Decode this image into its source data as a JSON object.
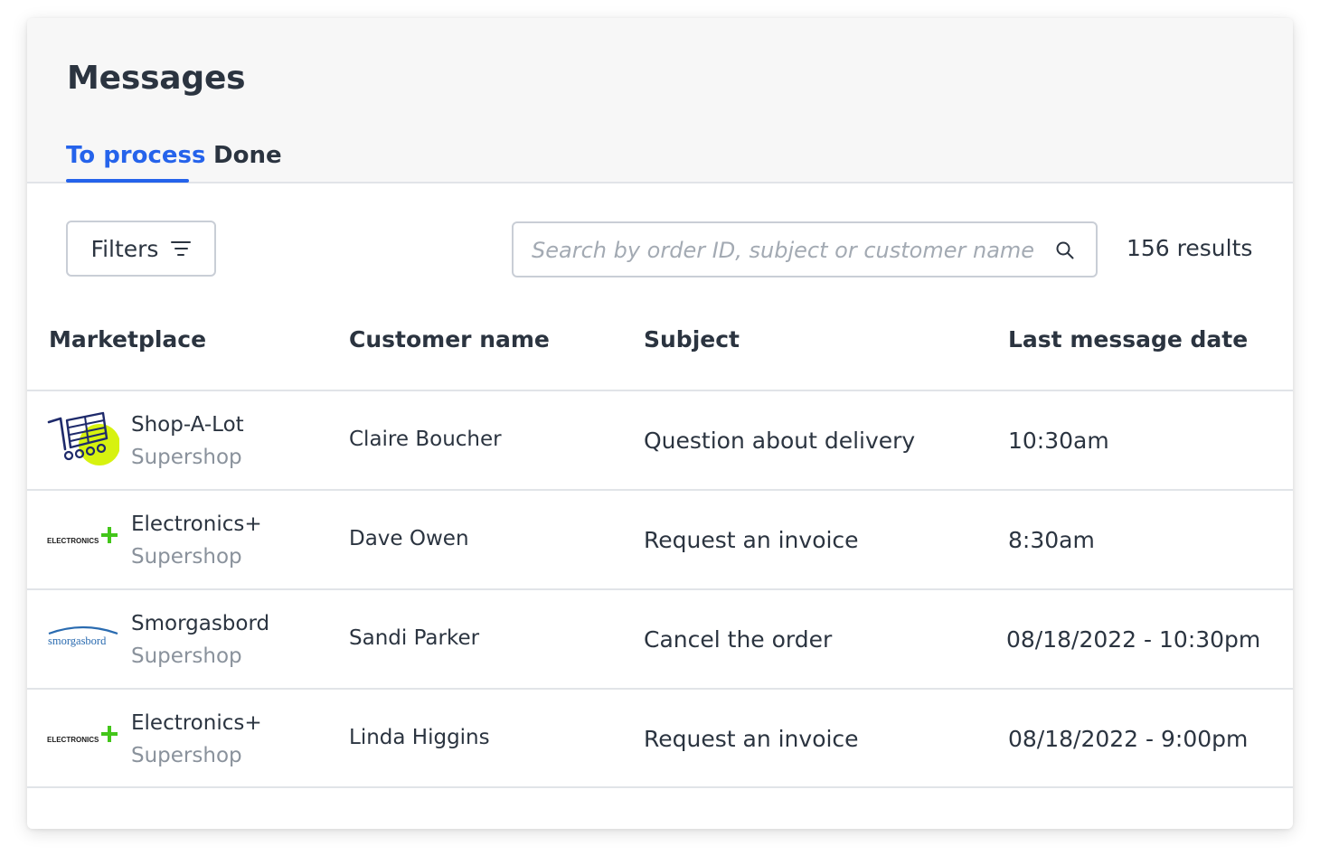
{
  "page": {
    "title": "Messages"
  },
  "tabs": [
    {
      "label": "To process",
      "active": true
    },
    {
      "label": "Done",
      "active": false
    }
  ],
  "toolbar": {
    "filters_label": "Filters",
    "search_placeholder": "Search by order ID, subject or customer name",
    "search_value": "",
    "results_text": "156 results"
  },
  "table": {
    "columns": [
      "Marketplace",
      "Customer name",
      "Subject",
      "Last message date"
    ],
    "rows": [
      {
        "logo": "shop-a-lot-logo",
        "marketplace": "Shop-A-Lot",
        "shop": "Supershop",
        "customer": "Claire Boucher",
        "subject": "Question about delivery",
        "date": "10:30am"
      },
      {
        "logo": "electronics-plus-logo",
        "logo_text": "ELECTRONICS",
        "marketplace": "Electronics+",
        "shop": "Supershop",
        "customer": "Dave Owen",
        "subject": "Request an invoice",
        "date": "8:30am"
      },
      {
        "logo": "smorgasbord-logo",
        "logo_text": "smorgasbord",
        "marketplace": "Smorgasbord",
        "shop": "Supershop",
        "customer": "Sandi Parker",
        "subject": "Cancel the order",
        "date": "08/18/2022 - 10:30pm"
      },
      {
        "logo": "electronics-plus-logo",
        "logo_text": "ELECTRONICS",
        "marketplace": "Electronics+",
        "shop": "Supershop",
        "customer": "Linda Higgins",
        "subject": "Request an invoice",
        "date": "08/18/2022 - 9:00pm"
      }
    ]
  },
  "colors": {
    "accent": "#2563eb",
    "header_bg": "#f7f7f7",
    "lime": "#d7f20f",
    "electronics_green": "#43c61a",
    "smorgasbord_blue": "#2a6bb0"
  }
}
